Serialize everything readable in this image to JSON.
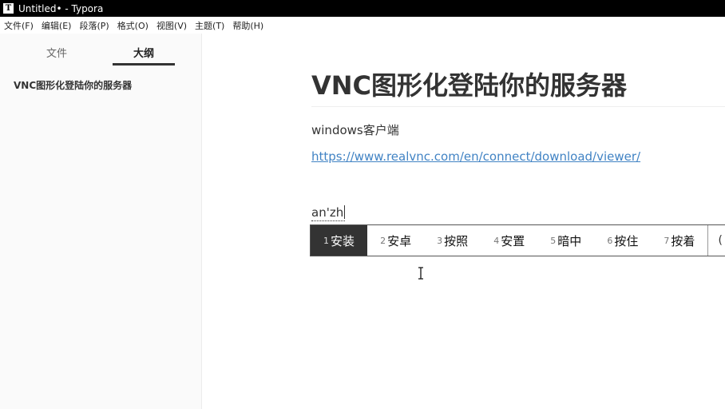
{
  "window": {
    "title": "Untitled• - Typora",
    "app_icon_glyph": "T"
  },
  "menu": [
    {
      "label": "文件(F)"
    },
    {
      "label": "编辑(E)"
    },
    {
      "label": "段落(P)"
    },
    {
      "label": "格式(O)"
    },
    {
      "label": "视图(V)"
    },
    {
      "label": "主题(T)"
    },
    {
      "label": "帮助(H)"
    }
  ],
  "sidebar": {
    "tabs": [
      {
        "label": "文件",
        "active": false
      },
      {
        "label": "大纲",
        "active": true
      }
    ],
    "outline": [
      {
        "label": "VNC图形化登陆你的服务器"
      }
    ]
  },
  "document": {
    "heading": "VNC图形化登陆你的服务器",
    "paragraph": "windows客户端",
    "link": "https://www.realvnc.com/en/connect/download/viewer/",
    "composition": "an'zh"
  },
  "ime": {
    "candidates": [
      {
        "num": "1",
        "text": "安装",
        "selected": true
      },
      {
        "num": "2",
        "text": "安卓",
        "selected": false
      },
      {
        "num": "3",
        "text": "按照",
        "selected": false
      },
      {
        "num": "4",
        "text": "安置",
        "selected": false
      },
      {
        "num": "5",
        "text": "暗中",
        "selected": false
      },
      {
        "num": "6",
        "text": "按住",
        "selected": false
      },
      {
        "num": "7",
        "text": "按着",
        "selected": false
      }
    ],
    "more_glyph": "("
  },
  "colors": {
    "titlebar": "#000000",
    "sidebar_bg": "#fafafa",
    "link": "#4183c4",
    "ime_selected": "#333333"
  }
}
